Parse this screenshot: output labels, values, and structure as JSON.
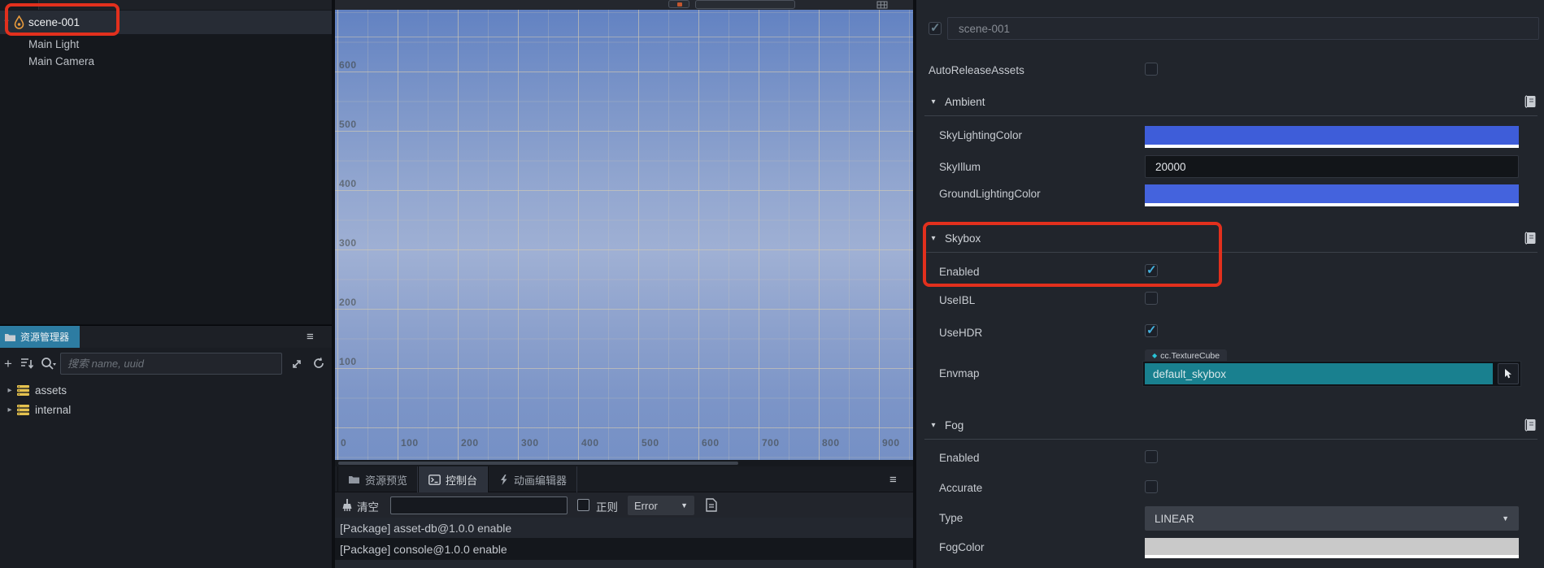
{
  "colors": {
    "annotation_red": "#e2301d",
    "assets_tab_active_bg": "#2d7ca2",
    "sky_lighting_color_bar": "#3e5dd9",
    "ground_lighting_color_bar": "#4463dd",
    "envmap_bar_teal": "#19808f",
    "fog_color_bar": "#c9c9c9",
    "checkbox_check": "#44b3e0",
    "folder_icon_yellow": "#e5c24f",
    "scene_sky_top": "#6282c2",
    "scene_sky_light": "#9fb0d4"
  },
  "icons": {
    "hamburger": "≡",
    "caret_down": "▾",
    "caret_right": "▸",
    "dropdown_arrow": "▼",
    "plus": "+",
    "diamond": "◆",
    "check": "✓"
  },
  "hierarchy": {
    "items": [
      {
        "label": "scene-001"
      },
      {
        "label": "Main Light"
      },
      {
        "label": "Main Camera"
      }
    ]
  },
  "assets_panel": {
    "tab_label": "资源管理器",
    "search_placeholder": "搜索 name, uuid",
    "folders": [
      {
        "label": "assets"
      },
      {
        "label": "internal"
      }
    ]
  },
  "scene_view": {
    "x_labels": [
      "0",
      "100",
      "200",
      "300",
      "400",
      "500",
      "600",
      "700",
      "800",
      "900"
    ],
    "y_labels": [
      "600",
      "500",
      "400",
      "300",
      "200",
      "100"
    ]
  },
  "console": {
    "tabs": [
      {
        "label": "资源预览"
      },
      {
        "label": "控制台"
      },
      {
        "label": "动画编辑器"
      }
    ],
    "active_tab": "控制台",
    "clear_label": "清空",
    "regex_label": "正则",
    "level_filter": "Error",
    "logs": [
      "[Package] asset-db@1.0.0 enable",
      "[Package] console@1.0.0 enable"
    ]
  },
  "inspector": {
    "header": {
      "name": "scene-001",
      "state": "true"
    },
    "auto_release": {
      "label": "AutoReleaseAssets",
      "state": "false"
    },
    "ambient": {
      "title": "Ambient",
      "sky_lighting_color": {
        "label": "SkyLightingColor"
      },
      "sky_illum": {
        "label": "SkyIllum",
        "value": "20000"
      },
      "ground_lighting_color": {
        "label": "GroundLightingColor"
      }
    },
    "skybox": {
      "title": "Skybox",
      "enabled": {
        "label": "Enabled",
        "state": "true"
      },
      "use_ibl": {
        "label": "UseIBL",
        "state": "false"
      },
      "use_hdr": {
        "label": "UseHDR",
        "state": "true"
      },
      "envmap": {
        "label": "Envmap",
        "type_tag": "cc.TextureCube",
        "value": "default_skybox"
      }
    },
    "fog": {
      "title": "Fog",
      "enabled": {
        "label": "Enabled",
        "state": "false"
      },
      "accurate": {
        "label": "Accurate",
        "state": "false"
      },
      "type": {
        "label": "Type",
        "value": "LINEAR"
      },
      "fog_color": {
        "label": "FogColor"
      }
    }
  }
}
